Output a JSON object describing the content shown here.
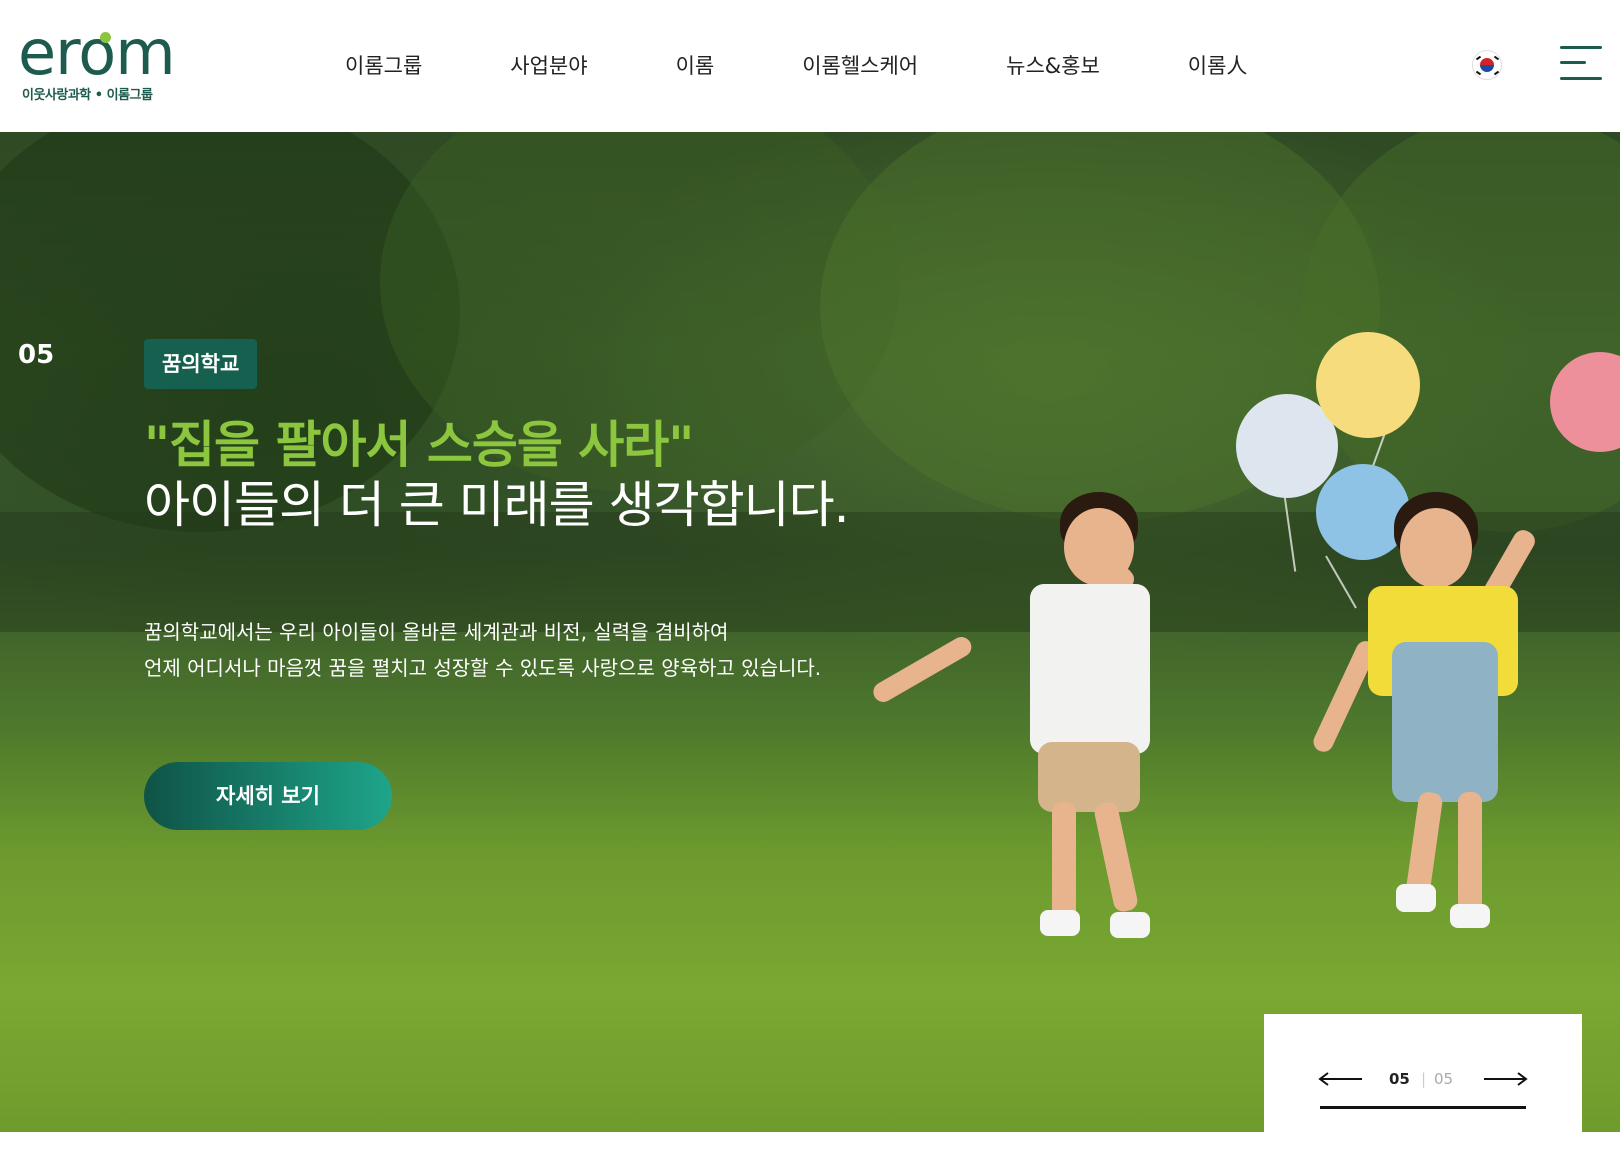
{
  "header": {
    "logo_text": "erom",
    "logo_subtitle": "이웃사랑과학 • 이롬그룹",
    "nav": [
      {
        "label": "이롬그룹"
      },
      {
        "label": "사업분야"
      },
      {
        "label": "이롬"
      },
      {
        "label": "이롬헬스케어"
      },
      {
        "label": "뉴스&홍보"
      },
      {
        "label": "이롬人"
      }
    ],
    "language_icon": "korea-flag-icon",
    "menu_icon": "hamburger-menu-icon"
  },
  "hero": {
    "slide_number": "05",
    "tag": "꿈의학교",
    "headline": "\"집을 팔아서 스승을 사라\"",
    "subheadline": "아이들의 더 큰 미래를 생각합니다.",
    "description_lines": [
      "꿈의학교에서는 우리 아이들이 올바른 세계관과 비전, 실력을 겸비하여",
      "언제 어디서나 마음껏 꿈을 펼치고 성장할 수 있도록 사랑으로 양육하고 있습니다."
    ],
    "button_label": "자세히 보기"
  },
  "pager": {
    "current": "05",
    "separator": "|",
    "total": "05",
    "prev_icon": "arrow-left-icon",
    "next_icon": "arrow-right-icon",
    "progress": 1.0
  },
  "colors": {
    "brand_green": "#1d5b4e",
    "accent_lime": "#8cc63f",
    "button_gradient_start": "#0f5346",
    "button_gradient_end": "#1ea58a"
  }
}
